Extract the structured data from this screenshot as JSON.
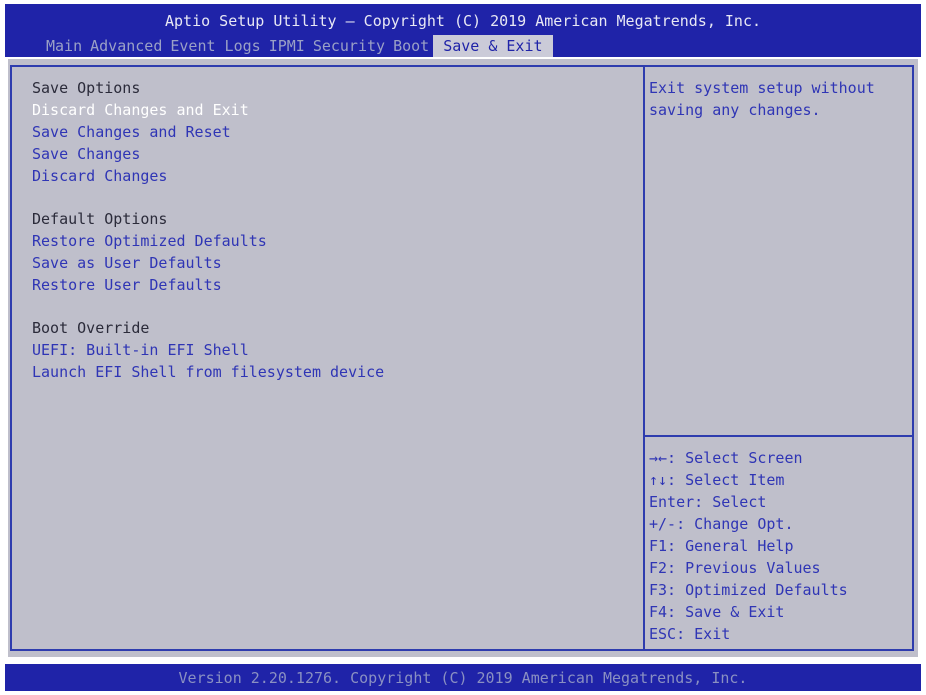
{
  "header": {
    "title": "Aptio Setup Utility – Copyright (C) 2019 American Megatrends, Inc.",
    "tabs": [
      {
        "label": "Main"
      },
      {
        "label": "Advanced"
      },
      {
        "label": "Event Logs"
      },
      {
        "label": "IPMI"
      },
      {
        "label": "Security"
      },
      {
        "label": "Boot"
      },
      {
        "label": "Save & Exit"
      }
    ],
    "active_tab": "Save & Exit"
  },
  "menu": {
    "save_options": {
      "heading": "Save Options",
      "items": [
        {
          "label": "Discard Changes and Exit"
        },
        {
          "label": "Save Changes and Reset"
        },
        {
          "label": "Save Changes"
        },
        {
          "label": "Discard Changes"
        }
      ]
    },
    "default_options": {
      "heading": "Default Options",
      "items": [
        {
          "label": "Restore Optimized Defaults"
        },
        {
          "label": "Save as User Defaults"
        },
        {
          "label": "Restore User Defaults"
        }
      ]
    },
    "boot_override": {
      "heading": "Boot Override",
      "items": [
        {
          "label": "UEFI: Built-in EFI Shell"
        },
        {
          "label": "Launch EFI Shell from filesystem device"
        }
      ]
    },
    "selected_item": "Discard Changes and Exit"
  },
  "help": {
    "text": "Exit system setup without saving any changes."
  },
  "keys": [
    "→←: Select Screen",
    "↑↓: Select Item",
    "Enter: Select",
    "+/-: Change Opt.",
    "F1: General Help",
    "F2: Previous Values",
    "F3: Optimized Defaults",
    "F4: Save & Exit",
    "ESC: Exit"
  ],
  "footer": {
    "text": "Version 2.20.1276. Copyright (C) 2019 American Megatrends, Inc."
  },
  "colors": {
    "bar_background": "#1f23a8",
    "panel_background": "#bfbfcb",
    "menu_item_text": "#2f35b5",
    "selected_item_text": "#ffffff",
    "heading_text": "#2b2b3a"
  }
}
